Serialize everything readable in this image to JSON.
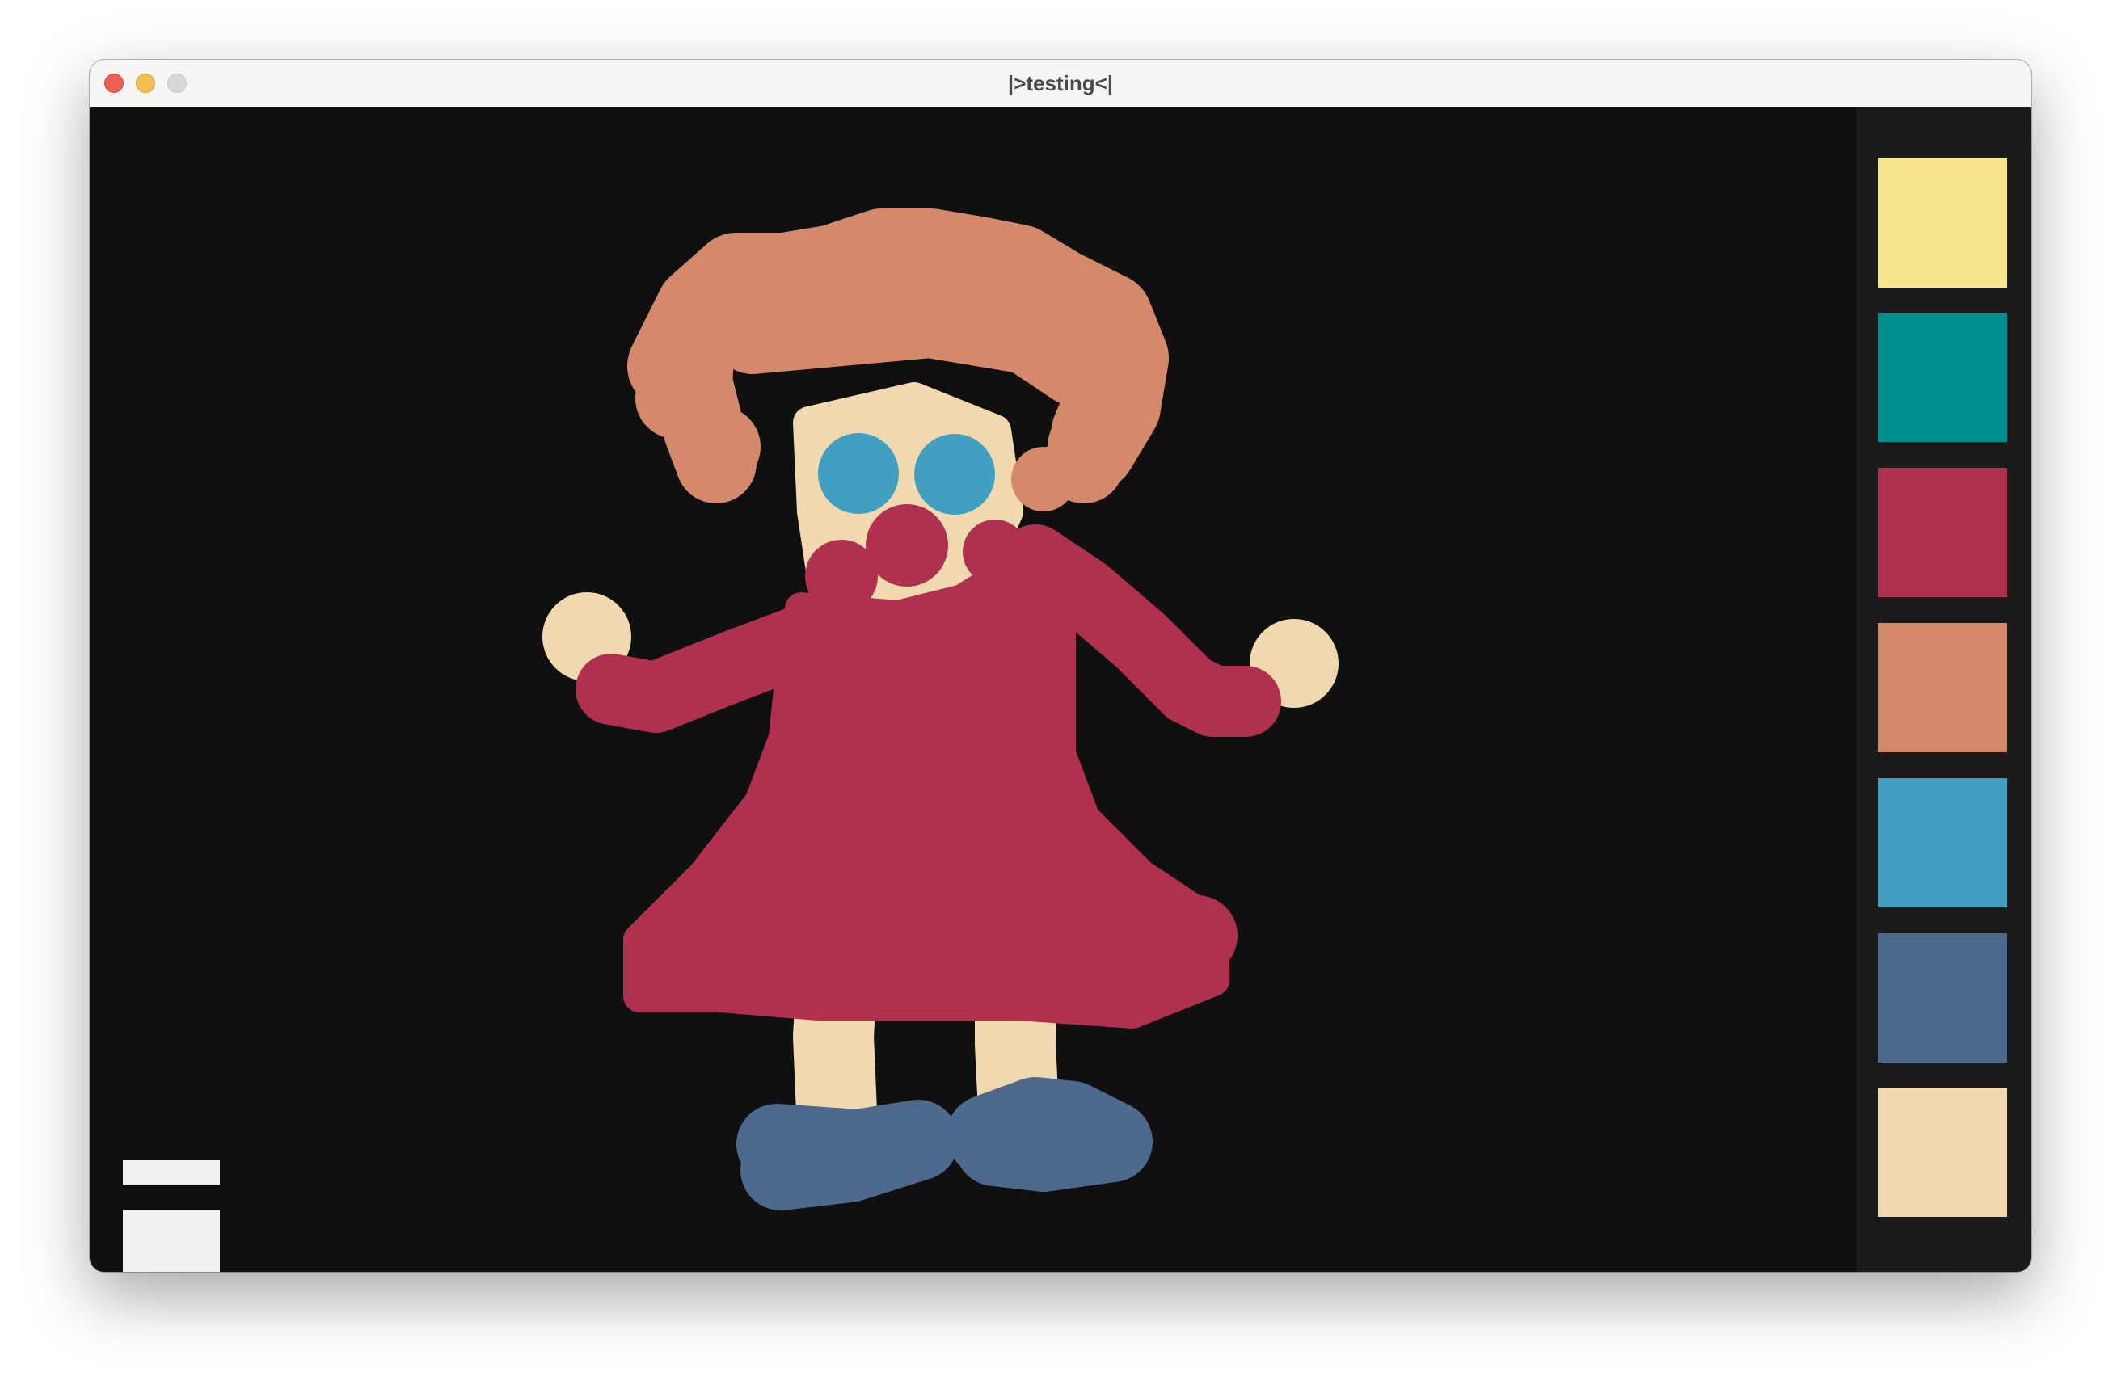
{
  "window": {
    "title": "|>testing<|"
  },
  "palette": {
    "colors": [
      "#f6e58d",
      "#008e8e",
      "#b03050",
      "#d4896b",
      "#419fc2",
      "#4e698e",
      "#f0d9ae"
    ]
  },
  "drawing_colors": {
    "hair": "#d4896b",
    "skin": "#f0d9ae",
    "eyes": "#419fc2",
    "nose": "#b03050",
    "dress": "#b03050",
    "shoes": "#4e698e",
    "background": "#101010"
  },
  "brush_sizes": [
    "small",
    "large"
  ]
}
